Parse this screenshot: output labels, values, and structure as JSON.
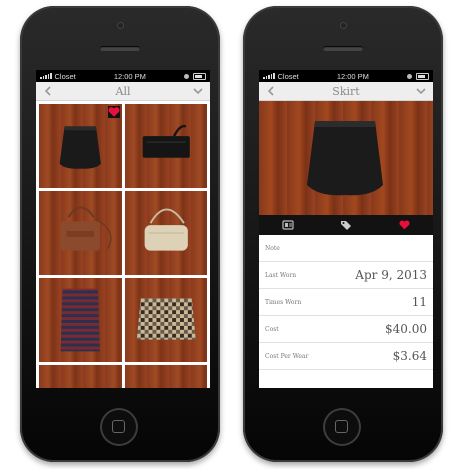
{
  "status": {
    "carrier": "Closet",
    "time": "12:00 PM"
  },
  "left": {
    "title": "All",
    "tiles": [
      {
        "item": "skirt",
        "favorite": true
      },
      {
        "item": "clutch"
      },
      {
        "item": "brown-bag"
      },
      {
        "item": "cream-bag"
      },
      {
        "item": "striped-skirt"
      },
      {
        "item": "knit-skirt"
      },
      {
        "item": "partial"
      },
      {
        "item": "partial"
      }
    ]
  },
  "right": {
    "title": "Skirt",
    "tabs": [
      "tag-icon",
      "label-icon",
      "heart-icon"
    ],
    "rows": [
      {
        "label": "Note",
        "value": ""
      },
      {
        "label": "Last Worn",
        "value": "Apr 9, 2013"
      },
      {
        "label": "Times Worn",
        "value": "11"
      },
      {
        "label": "Cost",
        "value": "$40.00"
      },
      {
        "label": "Cost Per Wear",
        "value": "$3.64"
      }
    ]
  },
  "colors": {
    "accent": "#e8103a",
    "wood": "#9a4222",
    "navbar": "#eeeeee"
  }
}
